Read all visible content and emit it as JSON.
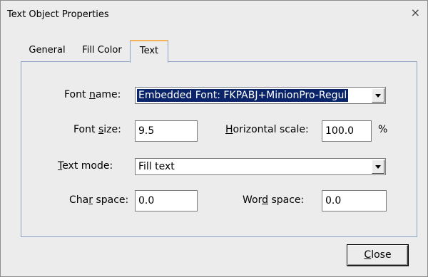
{
  "window": {
    "title": "Text Object Properties",
    "close_glyph": "×"
  },
  "tabs": [
    {
      "label": "General"
    },
    {
      "label": "Fill Color"
    },
    {
      "label": "Text"
    }
  ],
  "form": {
    "font_name": {
      "prefix": "Font ",
      "mnemonic": "n",
      "suffix": "ame:",
      "value": "Embedded Font: FKPABJ+MinionPro-Regul"
    },
    "font_size": {
      "prefix": "Font ",
      "mnemonic": "s",
      "suffix": "ize:",
      "value": "9.5"
    },
    "horizontal_scale": {
      "prefix": "",
      "mnemonic": "H",
      "suffix": "orizontal scale:",
      "value": "100.0",
      "unit": "%"
    },
    "text_mode": {
      "prefix": "",
      "mnemonic": "T",
      "suffix": "ext mode:",
      "value": "Fill text"
    },
    "char_space": {
      "prefix": "Cha",
      "mnemonic": "r",
      "suffix": " space:",
      "value": "0.0"
    },
    "word_space": {
      "prefix": "Wor",
      "mnemonic": "d",
      "suffix": " space:",
      "value": "0.0"
    }
  },
  "buttons": {
    "close": {
      "mnemonic": "C",
      "rest": "lose"
    }
  }
}
